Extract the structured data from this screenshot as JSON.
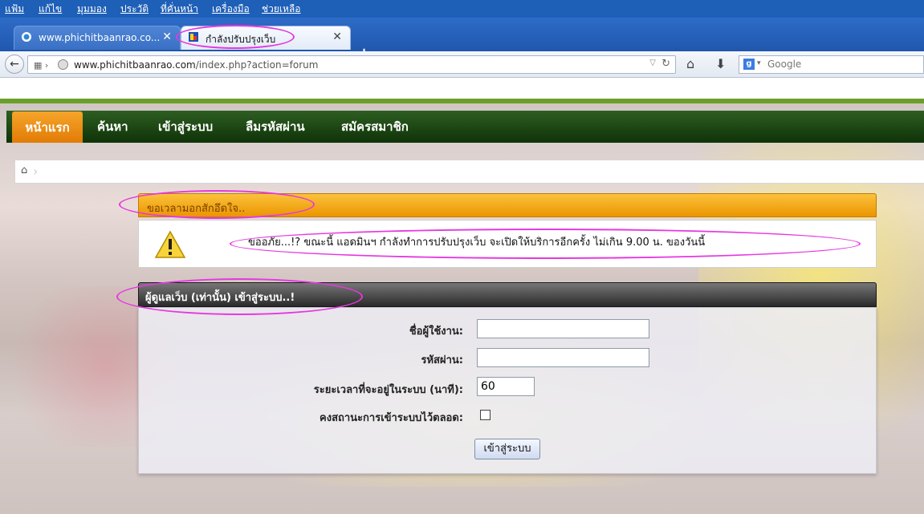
{
  "browser": {
    "menu": [
      "แฟ้ม",
      "แก้ไข",
      "มุมมอง",
      "ประวัติ",
      "ที่คั่นหน้า",
      "เครื่องมือ",
      "ช่วยเหลือ"
    ],
    "tabs": [
      {
        "title": "www.phichitbaanrao.co...",
        "icon": "globe-icon"
      },
      {
        "title": "กำลังปรับปรุงเว็บ",
        "icon": "pb-favicon"
      }
    ],
    "url": {
      "host": "www.phichitbaanrao.com",
      "path": "/index.php?action=forum"
    },
    "search_placeholder": "Google"
  },
  "site": {
    "nav": [
      "หน้าแรก",
      "ค้นหา",
      "เข้าสู่ระบบ",
      "ลืมรหัสผ่าน",
      "สมัครสมาชิก"
    ],
    "alert": {
      "title": "ขอเวลามอกสักอึดใจ..",
      "message": "ขออภัย...!? ขณะนี้ แอดมินฯ กำลังทำการปรับปรุงเว็บ จะเปิดให้บริการอีกครั้ง ไม่เกิน 9.00 น. ของวันนี้"
    },
    "login": {
      "title": "ผู้ดูแลเว็บ (เท่านั้น) เข้าสู่ระบบ..!",
      "username_label": "ชื่อผู้ใช้งาน:",
      "password_label": "รหัสผ่าน:",
      "duration_label": "ระยะเวลาที่จะอยู่ในระบบ (นาที):",
      "duration_value": "60",
      "stay_label": "คงสถานะการเข้าระบบไว้ตลอด:",
      "submit": "เข้าสู่ระบบ"
    }
  },
  "colors": {
    "annotation": "#e638e0",
    "nav_active": "#f08a12",
    "nav_bg": "#1d4a14"
  }
}
